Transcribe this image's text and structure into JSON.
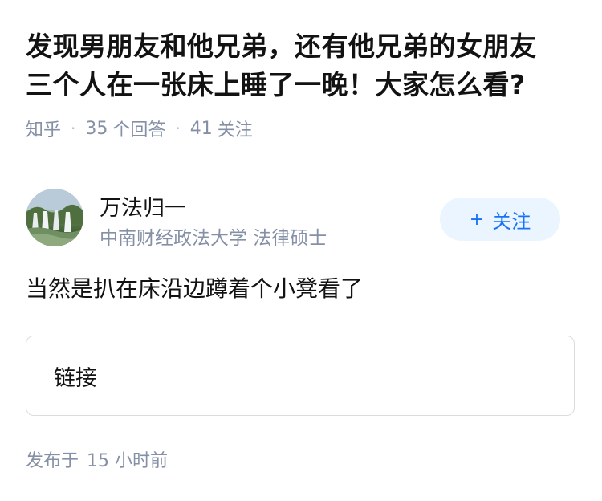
{
  "question": {
    "title_line1": "发现男朋友和他兄弟，还有他兄弟的女朋友",
    "title_line2": "三个人在一张床上睡了一晚！大家怎么看?",
    "source": "知乎",
    "separator": "·",
    "answers_count": "35",
    "answers_label": "个回答",
    "followers_count": "41",
    "followers_label": "关注"
  },
  "author": {
    "name": "万法归一",
    "bio": "中南财经政法大学 法律硕士",
    "avatar_icon": "landscape-waterfall-avatar",
    "follow_plus": "+",
    "follow_label": "关注"
  },
  "answer": {
    "text": "当然是扒在床沿边蹲着个小凳看了",
    "link_label": "链接",
    "publish_label": "发布于",
    "publish_count": "15",
    "publish_unit": "小时前"
  },
  "colors": {
    "text": "#121212",
    "meta": "#8590a6",
    "accent": "#1772f6",
    "follow_bg": "#ebf5ff",
    "border": "#dcdcdc"
  }
}
